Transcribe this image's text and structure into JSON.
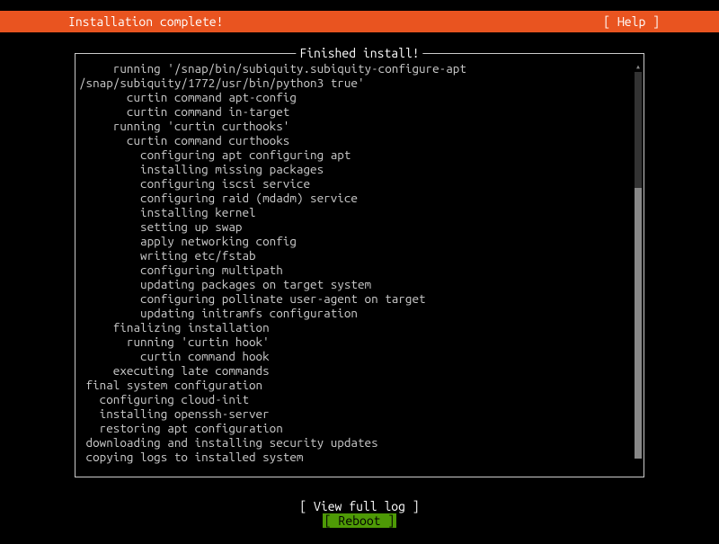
{
  "header": {
    "title": "Installation complete!",
    "help": "[ Help ]"
  },
  "log": {
    "title": " Finished install! ",
    "lines": [
      "     running '/snap/bin/subiquity.subiquity-configure-apt",
      "/snap/subiquity/1772/usr/bin/python3 true'",
      "       curtin command apt-config",
      "       curtin command in-target",
      "     running 'curtin curthooks'",
      "       curtin command curthooks",
      "         configuring apt configuring apt",
      "         installing missing packages",
      "         configuring iscsi service",
      "         configuring raid (mdadm) service",
      "         installing kernel",
      "         setting up swap",
      "         apply networking config",
      "         writing etc/fstab",
      "         configuring multipath",
      "         updating packages on target system",
      "         configuring pollinate user-agent on target",
      "         updating initramfs configuration",
      "     finalizing installation",
      "       running 'curtin hook'",
      "         curtin command hook",
      "     executing late commands",
      " final system configuration",
      "   configuring cloud-init",
      "   installing openssh-server",
      "   restoring apt configuration",
      " downloading and installing security updates",
      " copying logs to installed system"
    ]
  },
  "buttons": {
    "view_full_log": "[ View full log ]",
    "reboot": "[ Reboot       ]"
  }
}
